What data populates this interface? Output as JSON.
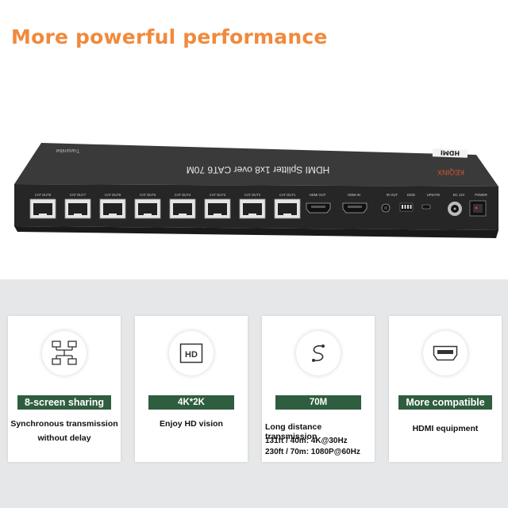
{
  "headline": "More powerful performance",
  "device": {
    "model_text": "HDMI Splitter 1x8 over CAT6 70M",
    "side_label": "Transmitter",
    "brand": "KEQINX",
    "hdmi_logo": "HDMI",
    "port_labels": [
      "CAT OUT8",
      "CAT OUT7",
      "CAT OUT6",
      "CAT OUT5",
      "CAT OUT4",
      "CAT OUT3",
      "CAT OUT2",
      "CAT OUT1",
      "HDMI OUT",
      "HDMI IN",
      "IR OUT",
      "EDID",
      "UPDATE",
      "DC 12V",
      "POWER"
    ]
  },
  "features": [
    {
      "icon": "network-screens-icon",
      "label": "8-screen sharing",
      "lines": [
        "Synchronous transmission",
        "without delay"
      ]
    },
    {
      "icon": "hd-icon",
      "label": "4K*2K",
      "lines": [
        "Enjoy HD vision"
      ]
    },
    {
      "icon": "cable-icon",
      "label": "70M",
      "lines": [
        "Long distance transmission",
        "131ft / 40m: 4K@30Hz",
        "230ft / 70m: 1080P@60Hz"
      ]
    },
    {
      "icon": "hdmi-port-icon",
      "label": "More compatible",
      "lines": [
        "HDMI equipment"
      ]
    }
  ],
  "colors": {
    "headline": "#f08a3c",
    "pill": "#2f5d3f",
    "device": "#2c2c2c",
    "brand": "#d9562b"
  }
}
